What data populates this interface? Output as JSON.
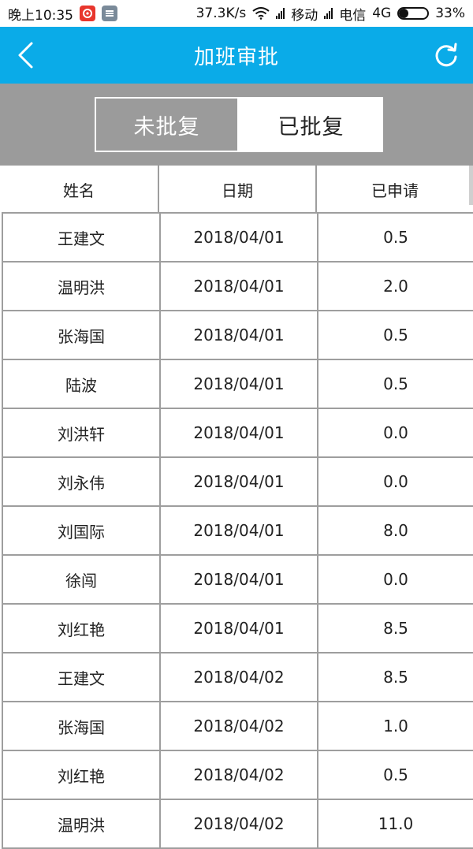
{
  "status_bar": {
    "time": "晚上10:35",
    "speed": "37.3K/s",
    "carrier1": "移动",
    "carrier2": "电信",
    "network": "4G",
    "battery": "33%",
    "battery_level": 0.33,
    "app_icon_color": "#e8362d",
    "app_icon2_color": "#7a8a99"
  },
  "header": {
    "title": "加班审批",
    "back_icon": "chevron-left-icon",
    "refresh_icon": "refresh-icon",
    "color": "#0aabe8"
  },
  "segments": {
    "unapproved": "未批复",
    "approved": "已批复",
    "selected": "approved"
  },
  "table": {
    "columns": [
      "姓名",
      "日期",
      "已申请"
    ],
    "rows": [
      [
        "王建文",
        "2018/04/01",
        "0.5"
      ],
      [
        "温明洪",
        "2018/04/01",
        "2.0"
      ],
      [
        "张海国",
        "2018/04/01",
        "0.5"
      ],
      [
        "陆波",
        "2018/04/01",
        "0.5"
      ],
      [
        "刘洪轩",
        "2018/04/01",
        "0.0"
      ],
      [
        "刘永伟",
        "2018/04/01",
        "0.0"
      ],
      [
        "刘国际",
        "2018/04/01",
        "8.0"
      ],
      [
        "徐闯",
        "2018/04/01",
        "0.0"
      ],
      [
        "刘红艳",
        "2018/04/01",
        "8.5"
      ],
      [
        "王建文",
        "2018/04/02",
        "8.5"
      ],
      [
        "张海国",
        "2018/04/02",
        "1.0"
      ],
      [
        "刘红艳",
        "2018/04/02",
        "0.5"
      ],
      [
        "温明洪",
        "2018/04/02",
        "11.0"
      ]
    ]
  }
}
